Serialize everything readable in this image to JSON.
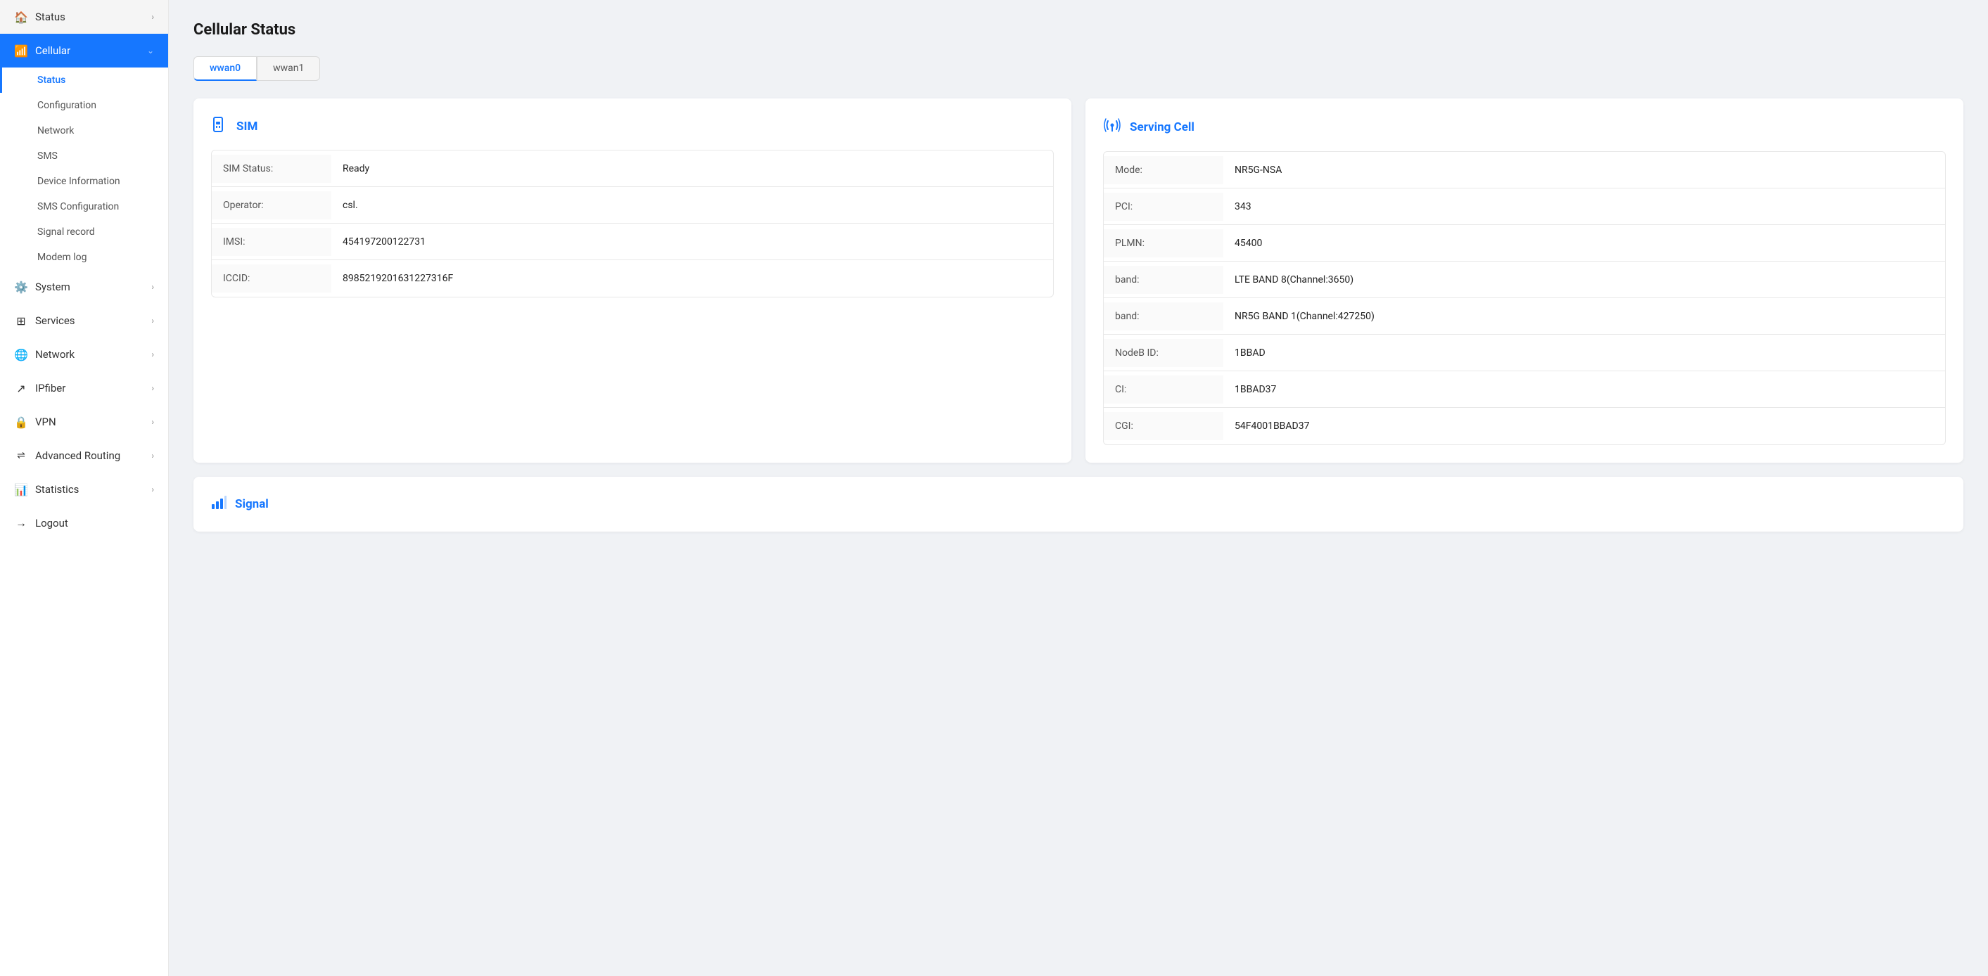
{
  "sidebar": {
    "items": [
      {
        "id": "status",
        "label": "Status",
        "icon": "🏠",
        "hasChevron": true,
        "active": false
      },
      {
        "id": "cellular",
        "label": "Cellular",
        "icon": "📶",
        "hasChevron": true,
        "active": true
      }
    ],
    "cellular_submenu": [
      {
        "id": "status",
        "label": "Status",
        "active": true
      },
      {
        "id": "configuration",
        "label": "Configuration",
        "active": false
      },
      {
        "id": "network",
        "label": "Network",
        "active": false
      },
      {
        "id": "sms",
        "label": "SMS",
        "active": false
      },
      {
        "id": "device-information",
        "label": "Device Information",
        "active": false
      },
      {
        "id": "sms-configuration",
        "label": "SMS Configuration",
        "active": false
      },
      {
        "id": "signal-record",
        "label": "Signal record",
        "active": false
      },
      {
        "id": "modem-log",
        "label": "Modem log",
        "active": false
      }
    ],
    "bottom_items": [
      {
        "id": "system",
        "label": "System",
        "icon": "⚙️",
        "hasChevron": true
      },
      {
        "id": "services",
        "label": "Services",
        "icon": "▦",
        "hasChevron": true
      },
      {
        "id": "network",
        "label": "Network",
        "icon": "🌐",
        "hasChevron": true
      },
      {
        "id": "ipfiber",
        "label": "IPfiber",
        "icon": "↗",
        "hasChevron": true
      },
      {
        "id": "vpn",
        "label": "VPN",
        "icon": "🔒",
        "hasChevron": true
      },
      {
        "id": "advanced-routing",
        "label": "Advanced Routing",
        "icon": "⇌",
        "hasChevron": true
      },
      {
        "id": "statistics",
        "label": "Statistics",
        "icon": "📊",
        "hasChevron": true
      },
      {
        "id": "logout",
        "label": "Logout",
        "icon": "→",
        "hasChevron": false
      }
    ]
  },
  "page": {
    "title": "Cellular Status"
  },
  "tabs": [
    {
      "id": "wwan0",
      "label": "wwan0",
      "active": true
    },
    {
      "id": "wwan1",
      "label": "wwan1",
      "active": false
    }
  ],
  "sim_card": {
    "section_title": "SIM",
    "rows": [
      {
        "label": "SIM Status:",
        "value": "Ready"
      },
      {
        "label": "Operator:",
        "value": "csl."
      },
      {
        "label": "IMSI:",
        "value": "454197200122731"
      },
      {
        "label": "ICCID:",
        "value": "8985219201631227316F"
      }
    ]
  },
  "serving_cell": {
    "section_title": "Serving Cell",
    "rows": [
      {
        "label": "Mode:",
        "value": "NR5G-NSA"
      },
      {
        "label": "PCI:",
        "value": "343"
      },
      {
        "label": "PLMN:",
        "value": "45400"
      },
      {
        "label": "band:",
        "value": "LTE BAND 8(Channel:3650)"
      },
      {
        "label": "band:",
        "value": "NR5G BAND 1(Channel:427250)"
      },
      {
        "label": "NodeB ID:",
        "value": "1BBAD"
      },
      {
        "label": "CI:",
        "value": "1BBAD37"
      },
      {
        "label": "CGI:",
        "value": "54F4001BBAD37"
      }
    ]
  },
  "signal_section": {
    "title": "Signal"
  }
}
